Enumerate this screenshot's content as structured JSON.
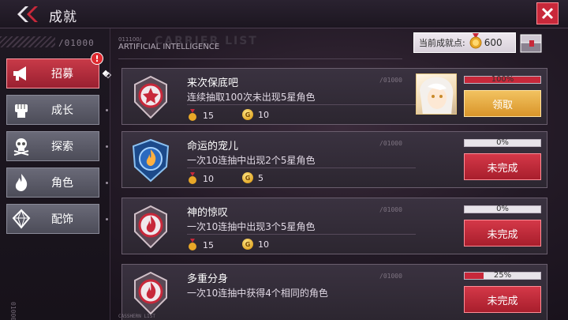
{
  "header": {
    "title": "成就"
  },
  "sidebar": {
    "code": "/01000",
    "vertical_code": "01000000",
    "badge": "!",
    "items": [
      {
        "label": "招募",
        "icon": "megaphone-icon",
        "active": true
      },
      {
        "label": "成长",
        "icon": "fist-icon",
        "active": false
      },
      {
        "label": "探索",
        "icon": "skull-icon",
        "active": false
      },
      {
        "label": "角色",
        "icon": "flame-icon",
        "active": false
      },
      {
        "label": "配饰",
        "icon": "gem-icon",
        "active": false
      }
    ]
  },
  "list": {
    "code": "011100/",
    "subtitle": "ARTIFICIAL INTELLIGENCE",
    "watermark": "CARRIER LIST",
    "footer": "CASSHERN LIST"
  },
  "points": {
    "label": "当前成就点:",
    "value": "600",
    "medal_icon": "medal-icon",
    "chest_icon": "chest-icon"
  },
  "achievements": [
    {
      "name": "来次保底吧",
      "desc": "连续抽取100次未出现5星角色",
      "code": "/01000",
      "medal": "15",
      "coin": "10",
      "progress_text": "100%",
      "progress": 1.0,
      "status": "领取",
      "emblem": "star",
      "emblem_color": "red",
      "has_avatar": true
    },
    {
      "name": "命运的宠儿",
      "desc": "一次10连抽中出现2个5星角色",
      "code": "/01000",
      "medal": "10",
      "coin": "5",
      "progress_text": "0%",
      "progress": 0.0,
      "status": "未完成",
      "emblem": "flame",
      "emblem_color": "blue",
      "has_avatar": false
    },
    {
      "name": "神的惊叹",
      "desc": "一次10连抽中出现3个5星角色",
      "code": "/01000",
      "medal": "15",
      "coin": "10",
      "progress_text": "0%",
      "progress": 0.0,
      "status": "未完成",
      "emblem": "flame",
      "emblem_color": "red",
      "has_avatar": false
    },
    {
      "name": "多重分身",
      "desc": "一次10连抽中获得4个相同的角色",
      "code": "/01000",
      "medal": "",
      "coin": "",
      "progress_text": "25%",
      "progress": 0.25,
      "status": "未完成",
      "emblem": "flame",
      "emblem_color": "red",
      "has_avatar": false
    }
  ],
  "colors": {
    "accent_red": "#c8283a",
    "claim_gold": "#d9952a"
  }
}
